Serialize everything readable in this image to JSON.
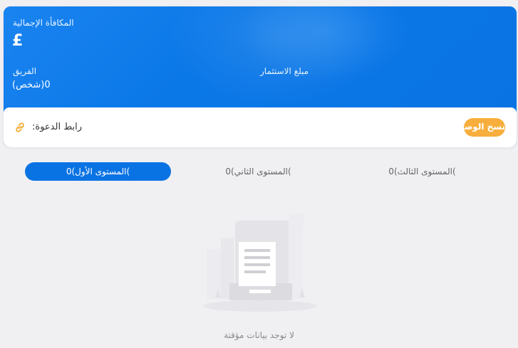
{
  "summary": {
    "total_reward_label": "المكافأة الإجمالية",
    "total_reward_value": "£",
    "team_label": "الفريق",
    "team_value": "(شخص)0",
    "investment_label": "مبلغ الاستثمار"
  },
  "invite": {
    "label": ":رابط الدعوة",
    "copy_button": "نسخ الوصلة"
  },
  "tabs": [
    {
      "label": "المستوى الأول)0(",
      "active": true
    },
    {
      "label": "المستوى الثاني)0(",
      "active": false
    },
    {
      "label": "المستوى الثالث)0(",
      "active": false
    }
  ],
  "empty_state": {
    "text": "لا توجد بيانات مؤقتة"
  },
  "colors": {
    "primary": "#0a73e3",
    "accent": "#f7ae3c",
    "background": "#f0f0f3"
  },
  "icons": {
    "invite": "link-icon",
    "empty": "empty-data-icon"
  }
}
